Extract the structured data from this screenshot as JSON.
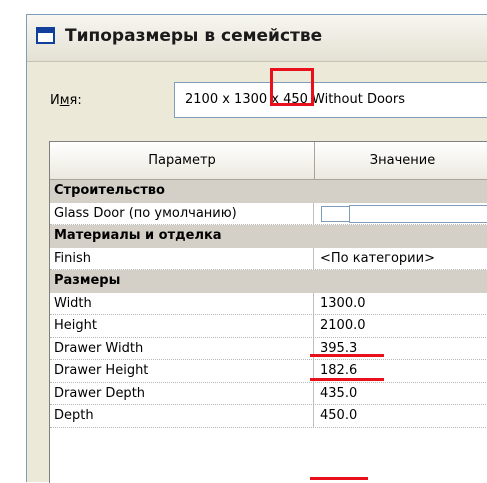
{
  "window": {
    "title": "Типоразмеры в семействе"
  },
  "name_field": {
    "label_prefix": "И",
    "label_underlined": "м",
    "label_suffix": "я:",
    "value": "2100 x 1300 x 450 Without Doors"
  },
  "grid": {
    "headers": {
      "parameter": "Параметр",
      "value": "Значение"
    },
    "groups": [
      {
        "title": "Строительство",
        "rows": [
          {
            "name": "Glass Door (по умолчанию)",
            "value": "",
            "type": "checkbox"
          }
        ]
      },
      {
        "title": "Материалы и отделка",
        "rows": [
          {
            "name": "Finish",
            "value": "<По категории>"
          }
        ]
      },
      {
        "title": "Размеры",
        "rows": [
          {
            "name": "Width",
            "value": "1300.0",
            "highlight": true
          },
          {
            "name": "Height",
            "value": "2100.0",
            "highlight": true
          },
          {
            "name": "Drawer Width",
            "value": "395.3"
          },
          {
            "name": "Drawer Height",
            "value": "182.6"
          },
          {
            "name": "Drawer Depth",
            "value": "435.0"
          },
          {
            "name": "Depth",
            "value": "450.0",
            "highlight": true
          }
        ]
      }
    ]
  },
  "annotation_color": "#e8101b"
}
